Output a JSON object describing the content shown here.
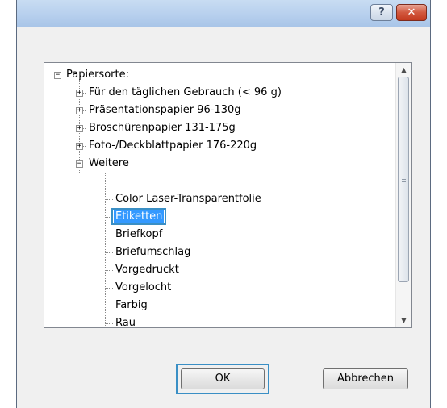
{
  "titlebar": {
    "help_label": "?",
    "close_label": "✕"
  },
  "tree": {
    "root": {
      "label": "Papiersorte:",
      "expander": "−"
    },
    "categories": [
      {
        "label": "Für den täglichen Gebrauch (< 96 g)",
        "expander": "+"
      },
      {
        "label": "Präsentationspapier 96-130g",
        "expander": "+"
      },
      {
        "label": "Broschürenpapier 131-175g",
        "expander": "+"
      },
      {
        "label": "Foto-/Deckblattpapier 176-220g",
        "expander": "+"
      },
      {
        "label": "Weitere",
        "expander": "−"
      }
    ],
    "subitems": [
      "Color Laser-Transparentfolie",
      "Etiketten",
      "Briefkopf",
      "Briefumschlag",
      "Vorgedruckt",
      "Vorgelocht",
      "Farbig",
      "Rau"
    ],
    "selected_item": "Etiketten"
  },
  "scrollbar": {
    "up_arrow": "▲",
    "down_arrow": "▼"
  },
  "buttons": {
    "ok_label": "OK",
    "cancel_label": "Abbrechen"
  }
}
